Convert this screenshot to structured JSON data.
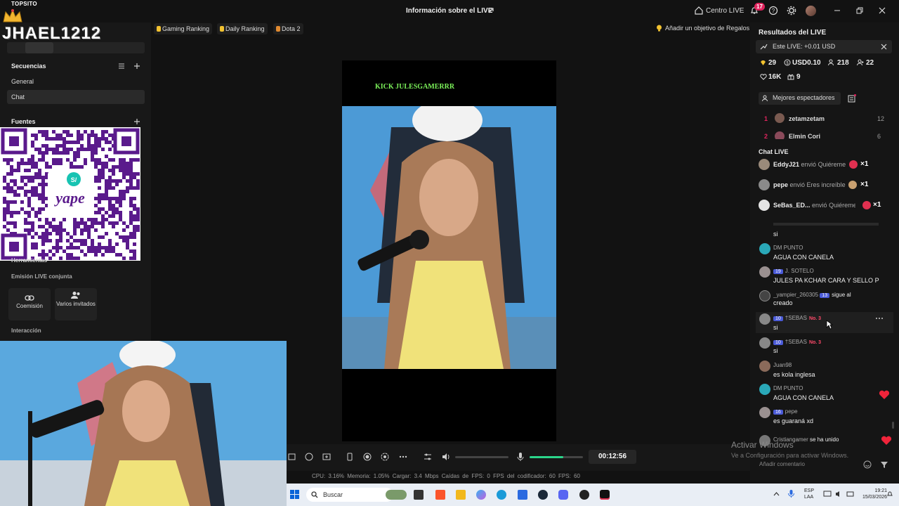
{
  "window": {
    "title": "Información sobre el LIVE",
    "centro_live": "Centro LIVE",
    "notif_count": "17"
  },
  "overlay": {
    "brand_small": "TOPSITO",
    "brand_name": "JHAEL1212"
  },
  "left_panel": {
    "secuencias": "Secuencias",
    "items": [
      "General",
      "Chat"
    ],
    "fuentes": "Fuentes",
    "herramientas": "Herramientas",
    "emision": "Emisión LIVE conjunta",
    "tools": [
      "Coemisión",
      "Varios invitados"
    ],
    "interaccion": "Interacción"
  },
  "qr": {
    "brand": "yape",
    "badge": "S/"
  },
  "top_chips": [
    "Gaming Ranking",
    "Daily Ranking",
    "Dota 2"
  ],
  "goal": "Añadir un objetivo de Regalos",
  "stream": {
    "overlay_text": "KICK JULESGAMERRR"
  },
  "controls": {
    "timer": "00:12:56",
    "mic_level": 0.63,
    "status": "CPU: 3.16%   Memoria: 1.05%   Cargar: 3.4 Mbps   Caídas de FPS: 0   FPS del codificador: 60   FPS: 60"
  },
  "right_panel": {
    "title": "Resultados del LIVE",
    "este_live": "Este LIVE: +0.01 USD",
    "stats": [
      "29",
      "USD0.10",
      "218",
      "22",
      "16K",
      "9"
    ],
    "mejores": "Mejores espectadores",
    "ranking": [
      {
        "pos": "1",
        "name": "zetamzetam",
        "value": "12"
      },
      {
        "pos": "2",
        "name": "Elmin Cori",
        "value": "6"
      }
    ],
    "chat_title": "Chat LIVE",
    "gifts": [
      {
        "user": "EddyJ21",
        "action": "envió Quiéreme",
        "count": "×1"
      },
      {
        "user": "pepe",
        "action": "envió Eres increíble",
        "count": "×1"
      },
      {
        "user": "SeBas_ED...",
        "action": "envió Quiéreme",
        "count": "×1"
      }
    ],
    "messages": [
      {
        "name": "DM PUNTO",
        "text": "AGUA CON CANELA"
      },
      {
        "name": "J. SOTELO",
        "level": "19",
        "text": "JULES PA KCHAR CARA Y SELLO P"
      },
      {
        "name": "_yampier_260305",
        "level": "13",
        "text": "creado",
        "extra": "sigue al"
      },
      {
        "name": "†SEBAS",
        "level": "10",
        "rank": "No. 3",
        "text": "si"
      },
      {
        "name": "†SEBAS",
        "level": "10",
        "rank": "No. 3",
        "text": "si"
      },
      {
        "name": "Juan98",
        "text": "es kola inglesa"
      },
      {
        "name": "DM PUNTO",
        "text": "AGUA CON CANELA"
      },
      {
        "name": "pepe",
        "level": "16",
        "text": "es guaraná xd"
      },
      {
        "name": "Cristiangamer",
        "text": "se ha unido"
      }
    ],
    "watermark1": "Activar Windows",
    "watermark2": "Ve a Configuración para activar Windows.",
    "comment_placeholder": "Añadir comentario"
  },
  "taskbar": {
    "search": "Buscar",
    "lang1": "ESP",
    "lang2": "LAA",
    "time": "19:21",
    "date": "15/03/2026"
  }
}
